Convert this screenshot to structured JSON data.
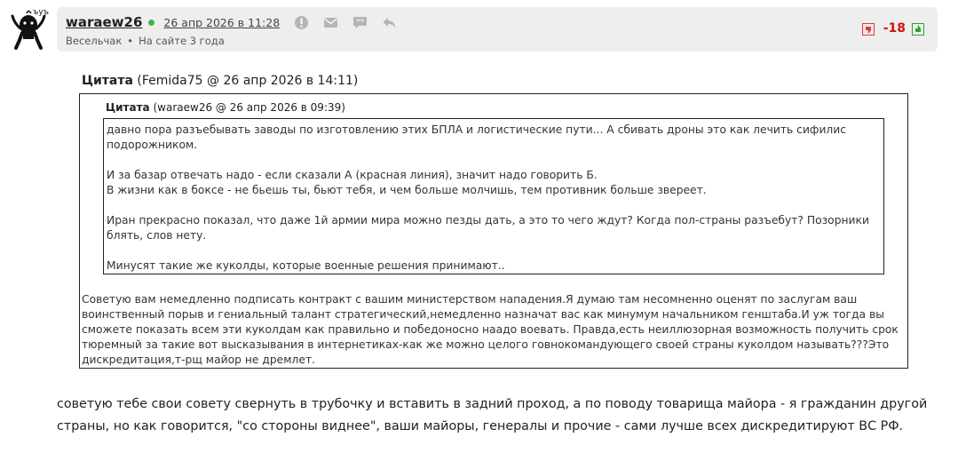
{
  "post": {
    "username": "waraew26",
    "date": "26 апр 2026 в 11:28",
    "rank": "Весельчак",
    "separator": "•",
    "tenure": "На сайте 3 года",
    "rating": "-18",
    "icons": [
      "warn-icon",
      "mail-icon",
      "quote-icon",
      "reply-icon",
      "thumb-down-icon",
      "thumb-up-icon"
    ],
    "online_color": "#3fb34f",
    "rating_color": "#d41111"
  },
  "outer_quote": {
    "label": "Цитата",
    "source": "(Femida75 @ 26 апр 2026 в 14:11)",
    "text": "Советую вам немедленно подписать контракт с вашим министерством нападения.Я думаю там несомненно оценят по заслугам ваш воинственный порыв и гениальный талант стратегический,немедленно назначат вас как минумум начальником генштаба.И уж тогда вы сможете показать всем эти куколдам как правильно и победоносно наадо воевать. Правда,есть неиллюзорная возможность получить срок тюремный за такие вот высказывания в интернетиках-как же можно целого говнокомандующего своей страны куколдом называть???Это дискредитация,т-рщ майор не дремлет."
  },
  "inner_quote": {
    "label": "Цитата",
    "source": "(waraew26 @ 26 апр 2026 в 09:39)",
    "paragraphs": [
      "давно пора разъебывать заводы по изготовлению этих БПЛА и логистические пути... А сбивать дроны это как лечить сифилис подорожником.",
      "И за базар отвечать надо - если сказали А (красная линия), значит надо говорить Б.",
      "В жизни как в боксе - не бьешь ты, бьют тебя, и чем больше молчишь, тем противник больше звереет.",
      "Иран прекрасно показал, что даже 1й армии мира можно пезды дать, а это то чего ждут? Когда пол-страны разъебут? Позорники блять, слов нету.",
      "Минусят такие же куколды, которые военные решения принимают.."
    ]
  },
  "reply": {
    "text": "советую тебе свои совету свернуть в трубочку и вставить в задний проход, а по поводу товарища майора - я гражданин другой страны, но как говорится, \"со стороны виднее\", ваши майоры, генералы и прочие - сами лучше всех дискредитируют ВС РФ."
  }
}
